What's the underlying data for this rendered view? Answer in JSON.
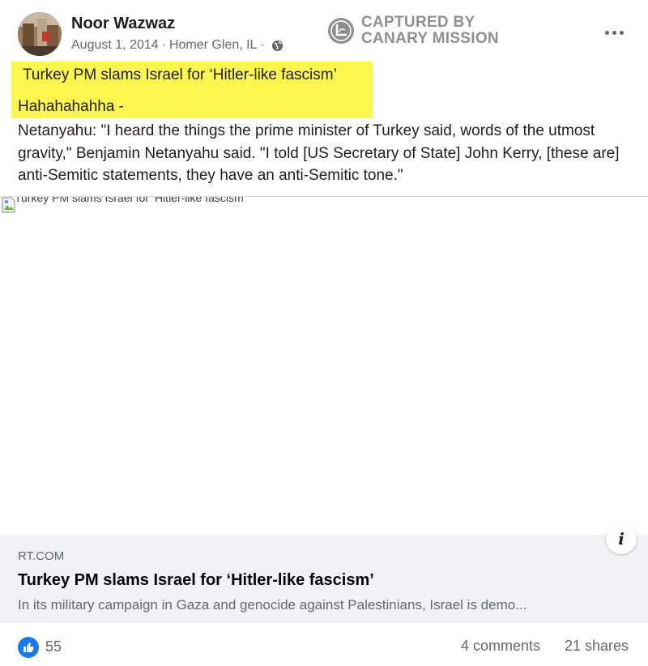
{
  "post": {
    "author": "Noor Wazwaz",
    "date": "August 1, 2014",
    "location": "Homer Glen, IL",
    "separator": "·",
    "privacy_icon": "globe-icon"
  },
  "watermark": {
    "line1": "CAPTURED BY",
    "line2": "CANARY MISSION"
  },
  "highlight": {
    "line1": "Turkey PM slams Israel for ‘Hitler-like fascism’",
    "line2": "Hahahahahha -"
  },
  "body_text": "Netanyahu: \"I  heard the things the prime minister of Turkey said, words of the utmost gravity,\" Benjamin Netanyahu said. \"I told [US Secretary of State] John Kerry, [these are] anti-Semitic statements, they have an anti-Semitic tone.\"",
  "image": {
    "alt_text": "Turkey PM slams Israel for ‘Hitler-like fascism’"
  },
  "link_card": {
    "domain": "RT.COM",
    "title": "Turkey PM slams Israel for ‘Hitler-like fascism’",
    "description": "In its military campaign in Gaza and genocide against Palestinians, Israel is demo..."
  },
  "footer": {
    "like_count": "55",
    "comments": "4 comments",
    "shares": "21 shares"
  },
  "colors": {
    "highlight": "#fdf64e",
    "like_blue": "#1877f2",
    "secondary_text": "#65676b"
  }
}
